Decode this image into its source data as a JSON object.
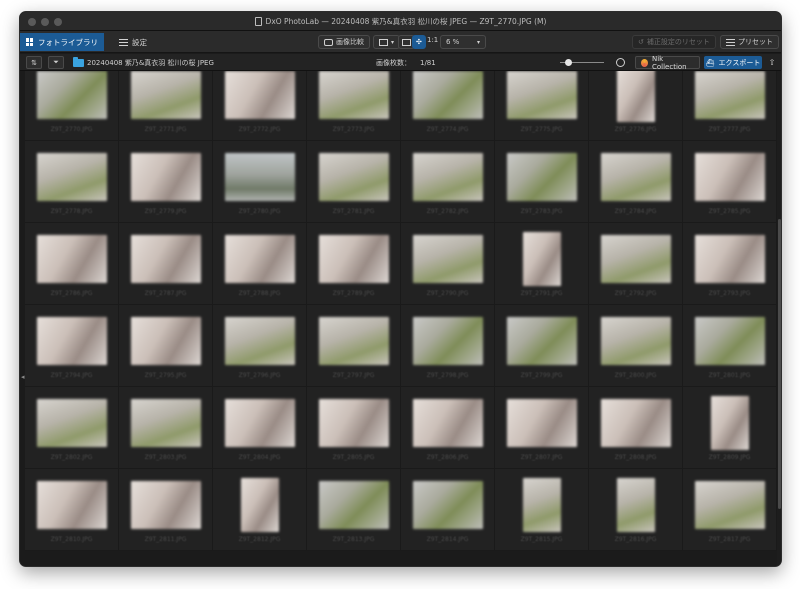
{
  "window": {
    "title": "DxO PhotoLab — 20240408 紫乃&真衣羽 松川の桜 JPEG — Z9T_2770.JPG (M)"
  },
  "toolbar": {
    "library_tab": "フォトライブラリ",
    "settings_tab": "設定",
    "compare_label": "画像比較",
    "ratio_label": "1:1",
    "zoom_value": "6 %",
    "reset_label": "補正設定のリセット",
    "preset_label": "プリセット"
  },
  "browser": {
    "folder_path": "20240408 紫乃&真衣羽 松川の桜 JPEG",
    "image_count_label": "画像枚数：",
    "image_count_value": "1/81",
    "nik_label": "Nik Collection",
    "export_label": "エクスポート"
  },
  "colors": {
    "accent": "#1c5b95",
    "folder": "#3aa3e0",
    "background": "#1b1b1b"
  },
  "icons": {
    "library": "grid-icon",
    "settings": "sliders-icon",
    "compare": "compare-icon",
    "layout": "layout-icon",
    "move": "move-icon",
    "sort": "sort-icon",
    "filter": "filter-icon",
    "folder": "folder-icon",
    "nik": "nik-icon",
    "export": "export-icon",
    "share": "share-icon"
  },
  "thumbnails": [
    {
      "orient": "l",
      "tone": "a",
      "name": "Z9T_2770.JPG"
    },
    {
      "orient": "l",
      "tone": "b",
      "name": "Z9T_2771.JPG"
    },
    {
      "orient": "l",
      "tone": "c",
      "name": "Z9T_2772.JPG"
    },
    {
      "orient": "l",
      "tone": "b",
      "name": "Z9T_2773.JPG"
    },
    {
      "orient": "l",
      "tone": "a",
      "name": "Z9T_2774.JPG"
    },
    {
      "orient": "l",
      "tone": "b",
      "name": "Z9T_2775.JPG"
    },
    {
      "orient": "p",
      "tone": "c",
      "name": "Z9T_2776.JPG"
    },
    {
      "orient": "l",
      "tone": "b",
      "name": "Z9T_2777.JPG"
    },
    {
      "orient": "l",
      "tone": "b",
      "name": "Z9T_2778.JPG"
    },
    {
      "orient": "l",
      "tone": "c",
      "name": "Z9T_2779.JPG"
    },
    {
      "orient": "l",
      "tone": "d",
      "name": "Z9T_2780.JPG"
    },
    {
      "orient": "l",
      "tone": "b",
      "name": "Z9T_2781.JPG"
    },
    {
      "orient": "l",
      "tone": "b",
      "name": "Z9T_2782.JPG"
    },
    {
      "orient": "l",
      "tone": "a",
      "name": "Z9T_2783.JPG"
    },
    {
      "orient": "l",
      "tone": "b",
      "name": "Z9T_2784.JPG"
    },
    {
      "orient": "l",
      "tone": "c",
      "name": "Z9T_2785.JPG"
    },
    {
      "orient": "l",
      "tone": "c",
      "name": "Z9T_2786.JPG"
    },
    {
      "orient": "l",
      "tone": "c",
      "name": "Z9T_2787.JPG"
    },
    {
      "orient": "l",
      "tone": "c",
      "name": "Z9T_2788.JPG"
    },
    {
      "orient": "l",
      "tone": "c",
      "name": "Z9T_2789.JPG"
    },
    {
      "orient": "l",
      "tone": "b",
      "name": "Z9T_2790.JPG"
    },
    {
      "orient": "p",
      "tone": "c",
      "name": "Z9T_2791.JPG"
    },
    {
      "orient": "l",
      "tone": "b",
      "name": "Z9T_2792.JPG"
    },
    {
      "orient": "l",
      "tone": "c",
      "name": "Z9T_2793.JPG"
    },
    {
      "orient": "l",
      "tone": "c",
      "name": "Z9T_2794.JPG"
    },
    {
      "orient": "l",
      "tone": "c",
      "name": "Z9T_2795.JPG"
    },
    {
      "orient": "l",
      "tone": "b",
      "name": "Z9T_2796.JPG"
    },
    {
      "orient": "l",
      "tone": "b",
      "name": "Z9T_2797.JPG"
    },
    {
      "orient": "l",
      "tone": "a",
      "name": "Z9T_2798.JPG"
    },
    {
      "orient": "l",
      "tone": "a",
      "name": "Z9T_2799.JPG"
    },
    {
      "orient": "l",
      "tone": "b",
      "name": "Z9T_2800.JPG"
    },
    {
      "orient": "l",
      "tone": "a",
      "name": "Z9T_2801.JPG"
    },
    {
      "orient": "l",
      "tone": "b",
      "name": "Z9T_2802.JPG"
    },
    {
      "orient": "l",
      "tone": "b",
      "name": "Z9T_2803.JPG"
    },
    {
      "orient": "l",
      "tone": "c",
      "name": "Z9T_2804.JPG"
    },
    {
      "orient": "l",
      "tone": "c",
      "name": "Z9T_2805.JPG"
    },
    {
      "orient": "l",
      "tone": "c",
      "name": "Z9T_2806.JPG"
    },
    {
      "orient": "l",
      "tone": "c",
      "name": "Z9T_2807.JPG"
    },
    {
      "orient": "l",
      "tone": "c",
      "name": "Z9T_2808.JPG"
    },
    {
      "orient": "p",
      "tone": "c",
      "name": "Z9T_2809.JPG"
    },
    {
      "orient": "l",
      "tone": "c",
      "name": "Z9T_2810.JPG"
    },
    {
      "orient": "l",
      "tone": "c",
      "name": "Z9T_2811.JPG"
    },
    {
      "orient": "p",
      "tone": "c",
      "name": "Z9T_2812.JPG"
    },
    {
      "orient": "l",
      "tone": "a",
      "name": "Z9T_2813.JPG"
    },
    {
      "orient": "l",
      "tone": "a",
      "name": "Z9T_2814.JPG"
    },
    {
      "orient": "p",
      "tone": "b",
      "name": "Z9T_2815.JPG"
    },
    {
      "orient": "p",
      "tone": "b",
      "name": "Z9T_2816.JPG"
    },
    {
      "orient": "l",
      "tone": "b",
      "name": "Z9T_2817.JPG"
    }
  ]
}
